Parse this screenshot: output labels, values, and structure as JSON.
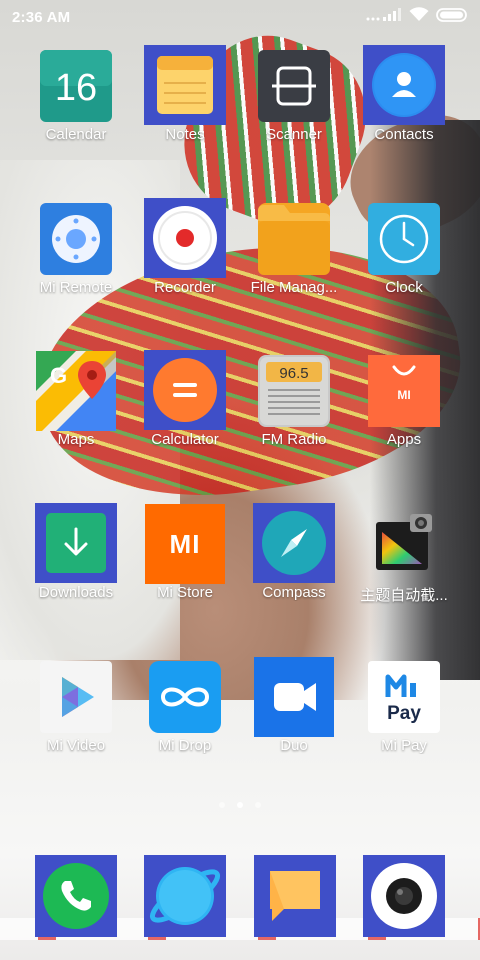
{
  "status_bar": {
    "time": "2:36 AM"
  },
  "apps": [
    {
      "label": "Calendar",
      "icon": "calendar-icon",
      "day": "16"
    },
    {
      "label": "Notes",
      "icon": "notes-icon"
    },
    {
      "label": "Scanner",
      "icon": "scanner-icon"
    },
    {
      "label": "Contacts",
      "icon": "contacts-icon"
    },
    {
      "label": "Mi Remote",
      "icon": "remote-icon"
    },
    {
      "label": "Recorder",
      "icon": "recorder-icon"
    },
    {
      "label": "File Manag...",
      "icon": "folder-icon"
    },
    {
      "label": "Clock",
      "icon": "clock-icon"
    },
    {
      "label": "Maps",
      "icon": "maps-icon"
    },
    {
      "label": "Calculator",
      "icon": "calculator-icon"
    },
    {
      "label": "FM Radio",
      "icon": "radio-icon",
      "frequency": "96.5"
    },
    {
      "label": "Apps",
      "icon": "app-store-icon"
    },
    {
      "label": "Downloads",
      "icon": "download-icon"
    },
    {
      "label": "Mi Store",
      "icon": "mi-store-icon",
      "logo": "MI"
    },
    {
      "label": "Compass",
      "icon": "compass-icon"
    },
    {
      "label": "主题自动截...",
      "icon": "theme-screenshot-icon"
    },
    {
      "label": "Mi Video",
      "icon": "video-play-icon"
    },
    {
      "label": "Mi Drop",
      "icon": "mi-drop-icon"
    },
    {
      "label": "Duo",
      "icon": "duo-video-icon"
    },
    {
      "label": "Mi Pay",
      "icon": "mi-pay-icon",
      "pay_text": "Pay"
    }
  ],
  "pages": {
    "count": 3,
    "active_index": 1
  },
  "dock": [
    {
      "icon": "phone-icon"
    },
    {
      "icon": "browser-icon"
    },
    {
      "icon": "messaging-icon"
    },
    {
      "icon": "camera-icon"
    }
  ],
  "colors": {
    "icon_highlight": "#3f4fc8",
    "calendar": "#1f9a8a",
    "folder": "#f5a623",
    "mi_orange": "#ff6a00",
    "phone_green": "#1db954"
  }
}
